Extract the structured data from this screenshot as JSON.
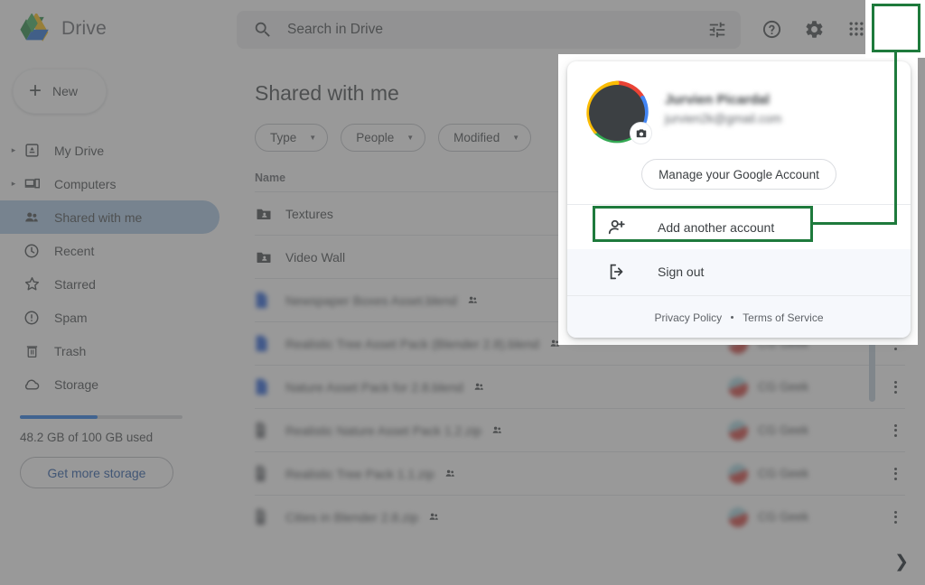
{
  "app": {
    "brand_name": "Drive",
    "logo_icon": "google-drive-logo"
  },
  "search": {
    "placeholder": "Search in Drive",
    "value": "",
    "search_icon": "search-icon",
    "tune_icon": "tune-filter-icon"
  },
  "header": {
    "help_icon": "help-circle-icon",
    "settings_icon": "gear-icon",
    "apps_icon": "apps-grid-icon",
    "avatar_icon": "account-avatar"
  },
  "sidebar": {
    "new_button": "New",
    "new_icon": "plus-icon",
    "items": [
      {
        "label": "My Drive",
        "icon": "my-drive-icon",
        "caret": true,
        "active": false
      },
      {
        "label": "Computers",
        "icon": "computers-icon",
        "caret": true,
        "active": false
      },
      {
        "label": "Shared with me",
        "icon": "shared-people-icon",
        "caret": false,
        "active": true
      },
      {
        "label": "Recent",
        "icon": "clock-icon",
        "caret": false,
        "active": false
      },
      {
        "label": "Starred",
        "icon": "star-icon",
        "caret": false,
        "active": false
      },
      {
        "label": "Spam",
        "icon": "spam-alert-icon",
        "caret": false,
        "active": false
      },
      {
        "label": "Trash",
        "icon": "trash-icon",
        "caret": false,
        "active": false
      },
      {
        "label": "Storage",
        "icon": "cloud-icon",
        "caret": false,
        "active": false
      }
    ],
    "storage": {
      "used_text": "48.2 GB of 100 GB used",
      "percent": 48,
      "bar_color": "#1a73e8",
      "cta_label": "Get more storage"
    }
  },
  "main": {
    "title": "Shared with me",
    "chips": [
      {
        "label": "Type",
        "arrow": "chevron-down-icon"
      },
      {
        "label": "People",
        "arrow": "chevron-down-icon"
      },
      {
        "label": "Modified",
        "arrow": "chevron-down-icon"
      }
    ],
    "column_header": "Name",
    "rows": [
      {
        "name": "Textures",
        "type": "folder",
        "shared": false,
        "owner": "",
        "blurred": false
      },
      {
        "name": "Video Wall",
        "type": "folder",
        "shared": false,
        "owner": "",
        "blurred": false
      },
      {
        "name": "Newspaper Boxes Asset.blend",
        "type": "blend",
        "shared": true,
        "owner": "",
        "blurred": true
      },
      {
        "name": "Realistic Tree Asset Pack (Blender 2.8).blend",
        "type": "blend",
        "shared": true,
        "owner": "CG Geek",
        "blurred": true
      },
      {
        "name": "Nature Asset Pack for 2.8.blend",
        "type": "blend",
        "shared": true,
        "owner": "CG Geek",
        "blurred": true
      },
      {
        "name": "Realistic Nature Asset Pack 1.2.zip",
        "type": "zip",
        "shared": true,
        "owner": "CG Geek",
        "blurred": true
      },
      {
        "name": "Realistic Tree Pack 1.1.zip",
        "type": "zip",
        "shared": true,
        "owner": "CG Geek",
        "blurred": true
      },
      {
        "name": "Cities in Blender 2.8.zip",
        "type": "zip",
        "shared": true,
        "owner": "CG Geek",
        "blurred": true
      }
    ],
    "next_page_icon": "chevron-right-icon"
  },
  "account_popup": {
    "name": "Jurvien Picardal",
    "email": "jurvien2k@gmail.com",
    "camera_badge_icon": "camera-icon",
    "manage_button": "Manage your Google Account",
    "items": [
      {
        "label": "Add another account",
        "icon": "person-add-icon"
      },
      {
        "label": "Sign out",
        "icon": "sign-out-icon"
      }
    ],
    "footer": {
      "privacy": "Privacy Policy",
      "terms": "Terms of Service"
    }
  },
  "annotation": {
    "color": "#1e7a3c",
    "targets": [
      "account-avatar",
      "add-another-account"
    ]
  }
}
